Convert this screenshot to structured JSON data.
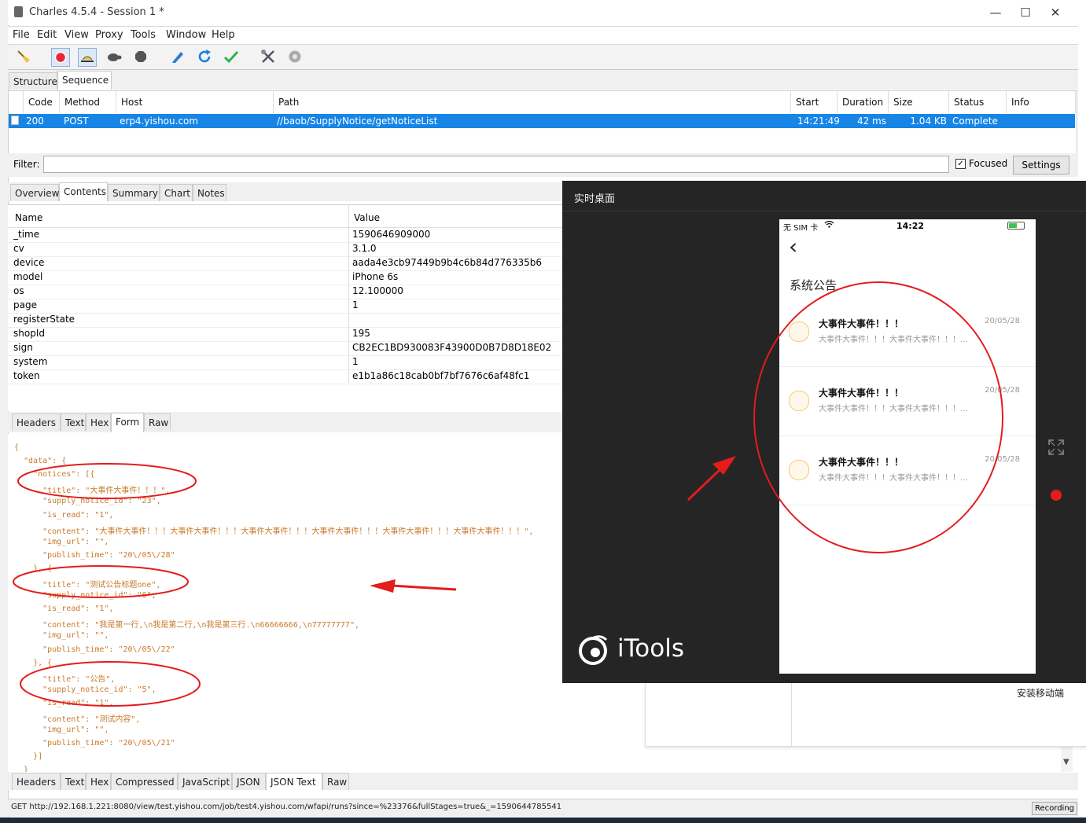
{
  "window": {
    "title": "Charles 4.5.4 - Session 1 *",
    "minimize": "—",
    "maximize": "☐",
    "close": "✕"
  },
  "menu": [
    "File",
    "Edit",
    "View",
    "Proxy",
    "Tools",
    "Window",
    "Help"
  ],
  "toolbar_icons": [
    "broom-icon",
    "record-icon",
    "throttle-icon",
    "turtle-icon",
    "stop-icon",
    "pen-icon",
    "refresh-icon",
    "check-icon",
    "tools-icon",
    "gear-icon"
  ],
  "view_tabs": [
    "Structure",
    "Sequence"
  ],
  "sequence": {
    "headers": [
      "Code",
      "Method",
      "Host",
      "Path",
      "Start",
      "Duration",
      "Size",
      "Status",
      "Info"
    ],
    "rows": [
      {
        "code": "200",
        "method": "POST",
        "host": "erp4.yishou.com",
        "path": "//baob/SupplyNotice/getNoticeList",
        "start": "14:21:49",
        "duration": "42 ms",
        "size": "1.04 KB",
        "status": "Complete",
        "info": ""
      }
    ]
  },
  "filter": {
    "label": "Filter:",
    "value": "",
    "focused_label": "Focused",
    "focused_checked": true,
    "settings_label": "Settings"
  },
  "content_tabs": [
    "Overview",
    "Contents",
    "Summary",
    "Chart",
    "Notes"
  ],
  "request_kv": {
    "headers": [
      "Name",
      "Value"
    ],
    "rows": [
      [
        "_time",
        "1590646909000"
      ],
      [
        "cv",
        "3.1.0"
      ],
      [
        "device",
        "aada4e3cb97449b9b4c6b84d776335b6"
      ],
      [
        "model",
        "iPhone 6s"
      ],
      [
        "os",
        "12.100000"
      ],
      [
        "page",
        "1"
      ],
      [
        "registerState",
        ""
      ],
      [
        "shopId",
        "195"
      ],
      [
        "sign",
        "CB2EC1BD930083F43900D0B7D8D18E02"
      ],
      [
        "system",
        "1"
      ],
      [
        "token",
        "e1b1a86c18cab0bf7bf7676c6af48fc1"
      ]
    ]
  },
  "request_tabs": [
    "Headers",
    "Text",
    "Hex",
    "Form",
    "Raw"
  ],
  "json_lines": [
    "{",
    "  \"data\": {",
    "    \"notices\": [{",
    "      \"title\": \"大事件大事件！！！\",",
    "      \"supply_notice_id\": \"23\",",
    "      \"is_read\": \"1\",",
    "      \"content\": \"大事件大事件！！！大事件大事件！！！大事件大事件！！！大事件大事件！！！大事件大事件！！！大事件大事件！！！\",",
    "      \"img_url\": \"\",",
    "      \"publish_time\": \"20\\/05\\/28\"",
    "    }, {",
    "      \"title\": \"测试公告标题one\",",
    "      \"supply_notice_id\": \"6\",",
    "      \"is_read\": \"1\",",
    "      \"content\": \"我是第一行,\\n我是第二行,\\n我是第三行.\\n66666666,\\n77777777\",",
    "      \"img_url\": \"\",",
    "      \"publish_time\": \"20\\/05\\/22\"",
    "    }, {",
    "      \"title\": \"公告\",",
    "      \"supply_notice_id\": \"5\",",
    "      \"is_read\": \"1\",",
    "      \"content\": \"测试内容\",",
    "      \"img_url\": \"\",",
    "      \"publish_time\": \"20\\/05\\/21\"",
    "    }]",
    "  }"
  ],
  "response_tabs": [
    "Headers",
    "Text",
    "Hex",
    "Compressed",
    "JavaScript",
    "JSON",
    "JSON Text",
    "Raw"
  ],
  "status": {
    "url": "GET http://192.168.1.221:8080/view/test.yishou.com/job/test4.yishou.com/wfapi/runs?since=%23376&fullStages=true&_=1590644785541",
    "recording": "Recording"
  },
  "itools": {
    "title": "实时桌面",
    "logo": "iTools",
    "install_label": "安装移动端",
    "phone": {
      "carrier": "无 SIM 卡",
      "time": "14:22",
      "back": "‹",
      "page_title": "系统公告",
      "notices": [
        {
          "title": "大事件大事件！！！",
          "date": "20/05/28",
          "content": "大事件大事件！！！大事件大事件！！！..."
        },
        {
          "title": "大事件大事件！！！",
          "date": "20/05/28",
          "content": "大事件大事件！！！大事件大事件！！！..."
        },
        {
          "title": "大事件大事件！！！",
          "date": "20/05/28",
          "content": "大事件大事件！！！大事件大事件！！！..."
        }
      ]
    }
  },
  "colors": {
    "selection": "#1685e6",
    "annotation": "#e41c1c",
    "json_text": "#c87a2a",
    "itools_bg": "#252525"
  }
}
